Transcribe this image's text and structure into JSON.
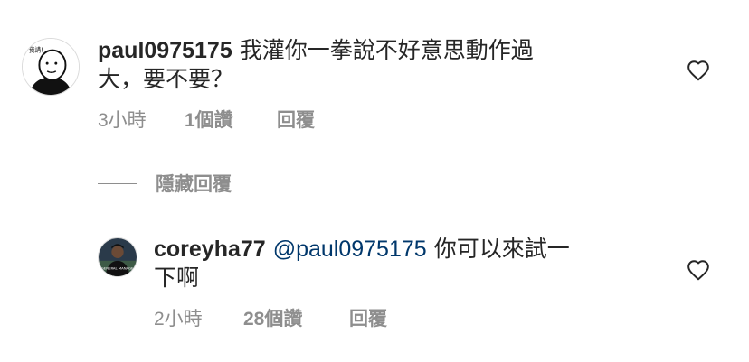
{
  "comments": [
    {
      "username": "paul0975175",
      "text_line1": "我灌你一拳說不好意思動作過",
      "text_line2": "大，要不要？",
      "time": "3小時",
      "likes": "1個讚",
      "reply_label": "回覆",
      "avatar_caption": "我講!"
    },
    {
      "username": "coreyha77",
      "mention": "@paul0975175",
      "text_line1": "你可以來試一",
      "text_line2": "下啊",
      "time": "2小時",
      "likes": "28個讚",
      "reply_label": "回覆",
      "avatar_caption": "GENERAL MANAGER"
    }
  ],
  "hide_replies_label": "隱藏回覆",
  "icons": {
    "like": "heart-outline-icon"
  },
  "colors": {
    "text": "#262626",
    "secondary": "#8e8e8e",
    "mention": "#00376b"
  }
}
